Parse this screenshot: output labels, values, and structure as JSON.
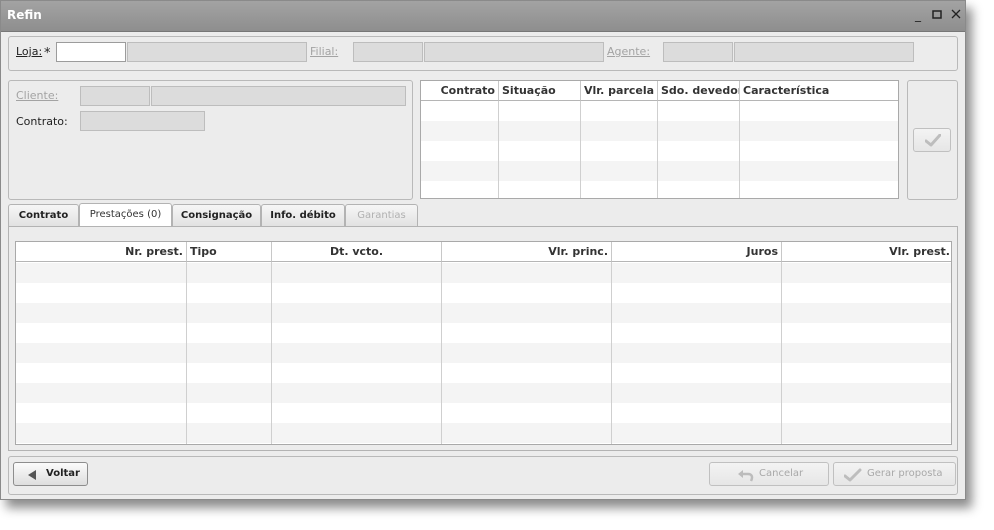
{
  "window": {
    "title": "Refin"
  },
  "header": {
    "loja_label": "Loja:",
    "required_mark": "*",
    "filial_label": "Filial:",
    "agente_label": "Agente:"
  },
  "client": {
    "cliente_label": "Cliente:",
    "contrato_label": "Contrato:"
  },
  "contracts_grid": {
    "columns": [
      "Contrato",
      "Situação",
      "Vlr. parcela",
      "Sdo. devedor",
      "Característica"
    ]
  },
  "tabs": [
    {
      "label": "Contrato"
    },
    {
      "label": "Prestações (0)"
    },
    {
      "label": "Consignação"
    },
    {
      "label": "Info. débito"
    },
    {
      "label": "Garantias"
    }
  ],
  "installments_grid": {
    "columns": [
      "Nr. prest.",
      "Tipo",
      "Dt. vcto.",
      "Vlr. princ.",
      "Juros",
      "Vlr. prest."
    ]
  },
  "footer": {
    "back_label": "Voltar",
    "cancel_label": "Cancelar",
    "generate_label": "Gerar proposta"
  }
}
